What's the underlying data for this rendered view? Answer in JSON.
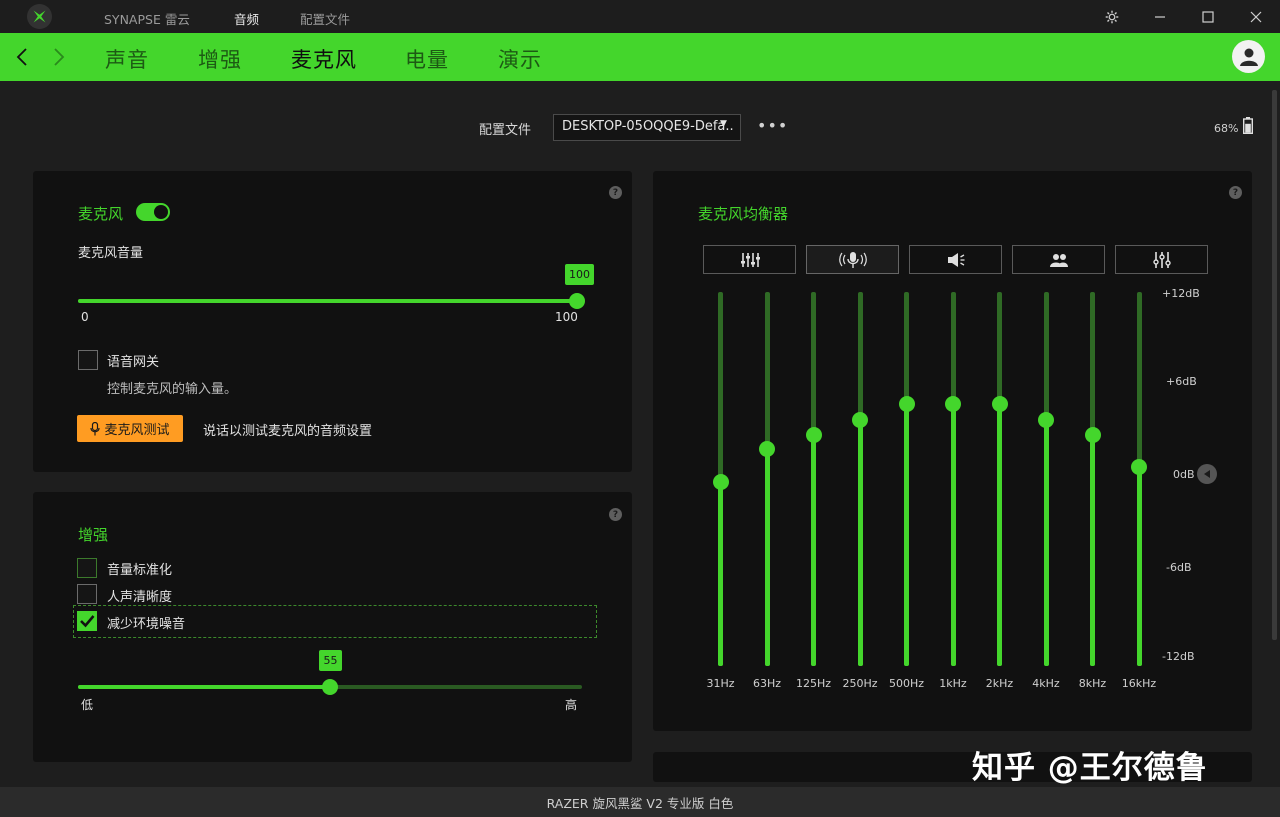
{
  "titlebar": {
    "tabs": [
      {
        "label": "SYNAPSE 雷云",
        "active": false
      },
      {
        "label": "音频",
        "active": true
      },
      {
        "label": "配置文件",
        "active": false
      }
    ],
    "controls": [
      "settings-icon",
      "minimize-icon",
      "maximize-icon",
      "close-icon"
    ]
  },
  "navbar": {
    "tabs": [
      {
        "label": "声音",
        "active": false
      },
      {
        "label": "增强",
        "active": false
      },
      {
        "label": "麦克风",
        "active": true
      },
      {
        "label": "电量",
        "active": false
      },
      {
        "label": "演示",
        "active": false
      }
    ]
  },
  "profile": {
    "label": "配置文件",
    "selected": "DESKTOP-05OQQE9-Defa..",
    "more": "•••"
  },
  "battery": {
    "percent_text": "68%",
    "level": 0.68
  },
  "mic_panel": {
    "title": "麦克风",
    "enabled": true,
    "volume_label": "麦克风音量",
    "volume_value": "100",
    "volume_fraction": 1.0,
    "min_label": "0",
    "max_label": "100",
    "voice_gate_label": "语音网关",
    "voice_gate_checked": false,
    "voice_gate_desc": "控制麦克风的输入量。",
    "test_button": "麦克风测试",
    "test_desc": "说话以测试麦克风的音频设置"
  },
  "enhance_panel": {
    "title": "增强",
    "options": [
      {
        "label": "音量标准化",
        "checked": false
      },
      {
        "label": "人声清晰度",
        "checked": false
      },
      {
        "label": "减少环境噪音",
        "checked": true
      }
    ],
    "noise_value": "55",
    "noise_fraction": 0.5,
    "low_label": "低",
    "high_label": "高"
  },
  "eq_panel": {
    "title": "麦克风均衡器",
    "presets": [
      {
        "icon": "equalizer-icon",
        "active": false
      },
      {
        "icon": "microphone-broadcast-icon",
        "active": true
      },
      {
        "icon": "megaphone-icon",
        "active": false
      },
      {
        "icon": "people-icon",
        "active": false
      },
      {
        "icon": "custom-sliders-icon",
        "active": false
      }
    ],
    "db_labels": [
      "+12dB",
      "+6dB",
      "0dB",
      "-6dB",
      "-12dB"
    ],
    "bands": [
      {
        "freq": "31Hz",
        "gain_db": -0.2
      },
      {
        "freq": "63Hz",
        "gain_db": 1.9
      },
      {
        "freq": "125Hz",
        "gain_db": 2.8
      },
      {
        "freq": "250Hz",
        "gain_db": 3.8
      },
      {
        "freq": "500Hz",
        "gain_db": 4.8
      },
      {
        "freq": "1kHz",
        "gain_db": 4.8
      },
      {
        "freq": "2kHz",
        "gain_db": 4.8
      },
      {
        "freq": "4kHz",
        "gain_db": 3.8
      },
      {
        "freq": "8kHz",
        "gain_db": 2.8
      },
      {
        "freq": "16kHz",
        "gain_db": 0.8
      }
    ]
  },
  "footer": {
    "device": "RAZER 旋风黑鲨 V2 专业版 白色"
  },
  "watermark": "知乎 @王尔德鲁"
}
